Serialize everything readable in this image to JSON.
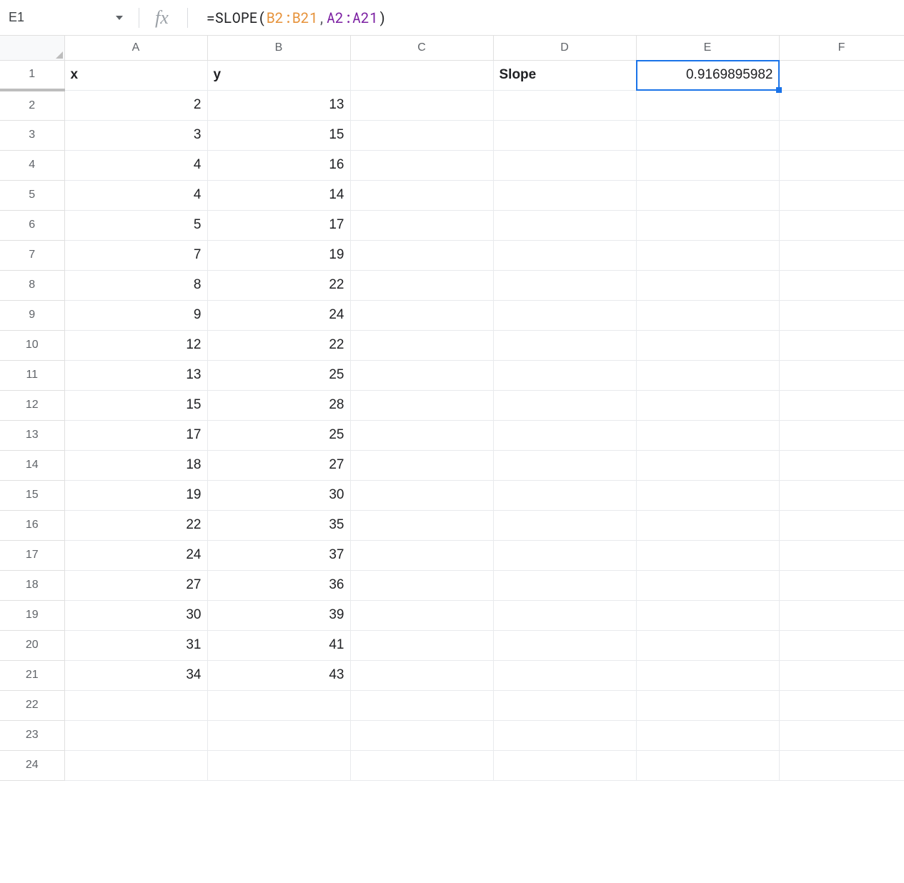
{
  "formula_bar": {
    "cell_ref": "E1",
    "formula_prefix": "=SLOPE",
    "paren_open": "(",
    "range1": "B2:B21",
    "comma": ", ",
    "range2": "A2:A21",
    "paren_close": ")"
  },
  "columns": [
    "A",
    "B",
    "C",
    "D",
    "E",
    "F"
  ],
  "rows": [
    1,
    2,
    3,
    4,
    5,
    6,
    7,
    8,
    9,
    10,
    11,
    12,
    13,
    14,
    15,
    16,
    17,
    18,
    19,
    20,
    21,
    22,
    23,
    24
  ],
  "cells": {
    "A1": "x",
    "B1": "y",
    "D1": "Slope",
    "E1": "0.9169895982",
    "A2": "2",
    "B2": "13",
    "A3": "3",
    "B3": "15",
    "A4": "4",
    "B4": "16",
    "A5": "4",
    "B5": "14",
    "A6": "5",
    "B6": "17",
    "A7": "7",
    "B7": "19",
    "A8": "8",
    "B8": "22",
    "A9": "9",
    "B9": "24",
    "A10": "12",
    "B10": "22",
    "A11": "13",
    "B11": "25",
    "A12": "15",
    "B12": "28",
    "A13": "17",
    "B13": "25",
    "A14": "18",
    "B14": "27",
    "A15": "19",
    "B15": "30",
    "A16": "22",
    "B16": "35",
    "A17": "24",
    "B17": "37",
    "A18": "27",
    "B18": "36",
    "A19": "30",
    "B19": "39",
    "A20": "31",
    "B20": "41",
    "A21": "34",
    "B21": "43"
  },
  "selected": "E1"
}
